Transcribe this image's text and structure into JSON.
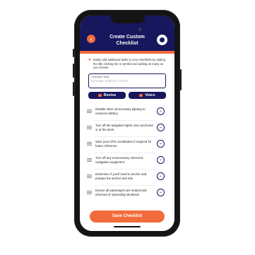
{
  "header": {
    "title_line1": "Create Custom",
    "title_line2": "Checklist"
  },
  "info": {
    "text": "Easily add additional tasks to your checklists by adding the title clicking the ⊕ symbol and adding as many as you choose."
  },
  "input": {
    "label": "Checklist Task",
    "placeholder": "Example: Replace Covers..."
  },
  "buttons": {
    "revise": "Revise",
    "voice": "Voice"
  },
  "items": [
    "Disable other unnecessary lighting to conserve battery.",
    "Turn off all navigation lights once anchored or at the dock.",
    "Save your GPS coordinates if required for future reference.",
    "Turn off any unnecessary electronic navigation equipment.",
    "Determine if you'll need to anchor and prepare the anchor and ride.",
    "Ensure all passengers are seated and informed of impending shutdown"
  ],
  "save_button": "Save Checklist",
  "colors": {
    "navy": "#16175d",
    "orange": "#f26b3a"
  }
}
